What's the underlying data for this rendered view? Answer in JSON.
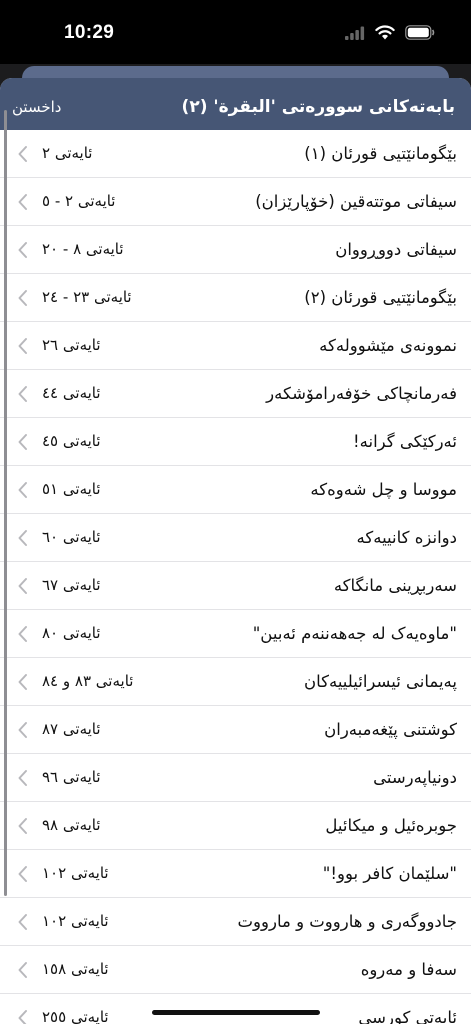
{
  "status_bar": {
    "time": "10:29",
    "icons": [
      "signal-icon",
      "wifi-icon",
      "battery-icon"
    ]
  },
  "nav": {
    "title": "بابەتەکانی سوورەتی 'البقرة' (٢)",
    "close_label": "داخستن"
  },
  "list": [
    {
      "title": "بێگومانێتیی قورئان (١)",
      "verse": "ئایەتی ٢"
    },
    {
      "title": "سیفاتی موتتەقین (خۆپارێزان)",
      "verse": "ئایەتی ٢ - ٥"
    },
    {
      "title": "سیفاتی دووڕووان",
      "verse": "ئایەتی ٨ - ٢٠"
    },
    {
      "title": "بێگومانێتیی قورئان (٢)",
      "verse": "ئایەتی ٢٣ - ٢٤"
    },
    {
      "title": "نموونەی مێشوولەکە",
      "verse": "ئایەتی ٢٦"
    },
    {
      "title": "فەرمانچاکی خۆفەرامۆشکەر",
      "verse": "ئایەتی ٤٤"
    },
    {
      "title": "ئەرکێکی گرانە!",
      "verse": "ئایەتی ٤٥"
    },
    {
      "title": "مووسا و چل شەوەکە",
      "verse": "ئایەتی ٥١"
    },
    {
      "title": "دوانزە کانییەکە",
      "verse": "ئایەتی ٦٠"
    },
    {
      "title": "سەربڕینی مانگاکە",
      "verse": "ئایەتی ٦٧"
    },
    {
      "title": "\"ماوەیەک لە جەهەننەم ئەبین\"",
      "verse": "ئایەتی ٨٠"
    },
    {
      "title": "پەیمانی ئیسرائیلییەکان",
      "verse": "ئایەتی ٨٣ و ٨٤"
    },
    {
      "title": "کوشتنی پێغەمبەران",
      "verse": "ئایەتی ٨٧"
    },
    {
      "title": "دونیاپەرستی",
      "verse": "ئایەتی ٩٦"
    },
    {
      "title": "جوبرەئیل و میکائیل",
      "verse": "ئایەتی ٩٨"
    },
    {
      "title": "\"سلێمان کافر بوو!\"",
      "verse": "ئایەتی ١٠٢"
    },
    {
      "title": "جادووگەری و هارووت و مارووت",
      "verse": "ئایەتی ١٠٢"
    },
    {
      "title": "سەفا و مەروە",
      "verse": "ئایەتی ١٥٨"
    },
    {
      "title": "ئایەتی کورسی",
      "verse": "ئایەتی ٢٥٥"
    }
  ]
}
